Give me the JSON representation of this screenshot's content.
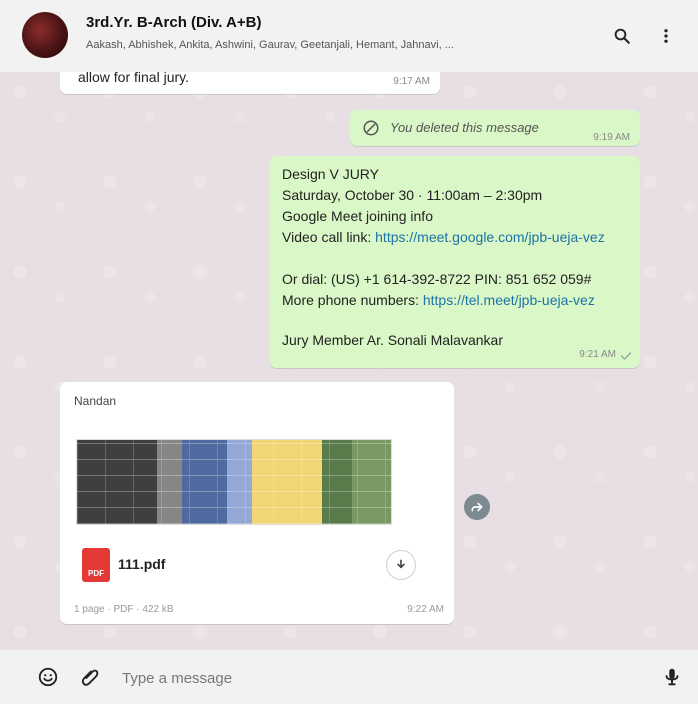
{
  "header": {
    "title": "3rd.Yr. B-Arch (Div. A+B)",
    "subtitle": "Aakash, Abhishek, Ankita, Ashwini, Gaurav, Geetanjali, Hemant, Jahnavi, ...",
    "icons": [
      "avatar",
      "search-icon",
      "more-vert-icon"
    ]
  },
  "messages": {
    "m1": {
      "text": "allow for final jury.",
      "time": "9:17 AM"
    },
    "m2": {
      "text": "You deleted this message",
      "time": "9:19 AM",
      "icon": "blocked-icon"
    },
    "m3": {
      "lines": [
        "Design V JURY",
        "Saturday, October 30 · 11:00am – 2:30pm",
        "Google Meet joining info",
        "Video call link: ",
        "Or dial: (US) +1 614-392-8722 PIN: 851 652 059#",
        "More phone numbers: ",
        "Jury Member  Ar. Sonali Malavankar"
      ],
      "video_link": "https://meet.google.com/jpb-ueja-vez",
      "phone_link": "https://tel.meet/jpb-ueja-vez",
      "time": "9:21 AM"
    },
    "m4": {
      "sender": "Nandan",
      "file_name": "111.pdf",
      "meta": "1 page · PDF · 422 kB",
      "time": "9:22 AM",
      "icons": [
        "pdf-icon",
        "download-icon",
        "forward-icon"
      ]
    }
  },
  "composer": {
    "placeholder": "Type a message",
    "icons": [
      "emoji-icon",
      "attach-icon",
      "mic-icon"
    ]
  }
}
